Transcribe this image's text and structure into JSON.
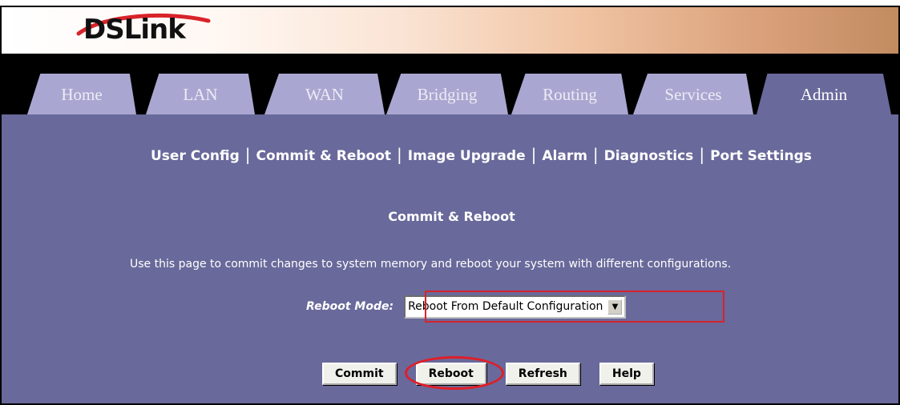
{
  "caption": "configuration.",
  "brand": {
    "logo_text": "DSLink"
  },
  "tabs": [
    {
      "label": "Home"
    },
    {
      "label": "LAN"
    },
    {
      "label": "WAN"
    },
    {
      "label": "Bridging"
    },
    {
      "label": "Routing"
    },
    {
      "label": "Services"
    },
    {
      "label": "Admin",
      "active": true
    }
  ],
  "subnav": [
    {
      "label": "User Config"
    },
    {
      "label": "Commit & Reboot"
    },
    {
      "label": "Image Upgrade"
    },
    {
      "label": "Alarm"
    },
    {
      "label": "Diagnostics"
    },
    {
      "label": "Port Settings"
    }
  ],
  "page": {
    "title": "Commit & Reboot",
    "description": "Use this page to commit changes to system memory and reboot your system with different configurations.",
    "reboot_mode_label": "Reboot Mode:",
    "reboot_mode_value": "Reboot From Default Configuration"
  },
  "buttons": {
    "commit": "Commit",
    "reboot": "Reboot",
    "refresh": "Refresh",
    "help": "Help"
  },
  "colors": {
    "content_bg": "#69699b",
    "tab_bg": "#a9a7d1",
    "highlight": "#e01e26"
  }
}
